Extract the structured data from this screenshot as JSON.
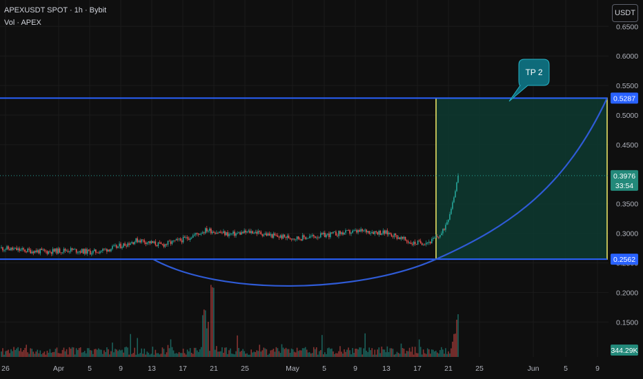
{
  "header": {
    "symbol_line": "APEXUSDT SPOT · 1h · Bybit",
    "volume_line": "Vol · APEX",
    "currency_button": "USDT"
  },
  "colors": {
    "background": "#0f0f0f",
    "level_line": "#2962ff",
    "curve": "#2f5bd6",
    "target_box_border": "#f7f06a",
    "target_box_fill": "#0d3a30",
    "bull": "#26a69a",
    "bear": "#ef5350",
    "label_tag": "#0e6b7a",
    "price_tag": "#23897a"
  },
  "annotations": {
    "tp_label": "TP 2",
    "upper_level": "0.5287",
    "lower_level": "0.2562",
    "current_price": "0.3976",
    "countdown": "33:54",
    "volume_value": "344.29K"
  },
  "chart_data": {
    "type": "candlestick",
    "interval": "1h",
    "y_axis_ticks": [
      "0.6500",
      "0.6000",
      "0.5500",
      "0.5000",
      "0.4500",
      "0.3500",
      "0.3000",
      "0.2500",
      "0.2000",
      "0.1500"
    ],
    "ylim": [
      0.12,
      0.66
    ],
    "x_axis_ticks": [
      "26",
      "Apr",
      "5",
      "9",
      "13",
      "17",
      "21",
      "25",
      "May",
      "5",
      "9",
      "13",
      "17",
      "21",
      "25",
      "Jun",
      "5",
      "9"
    ],
    "price_path": [
      {
        "t": 0,
        "price": 0.275
      },
      {
        "t": 0.05,
        "price": 0.271
      },
      {
        "t": 0.1,
        "price": 0.269
      },
      {
        "t": 0.15,
        "price": 0.272
      },
      {
        "t": 0.2,
        "price": 0.268
      },
      {
        "t": 0.25,
        "price": 0.276
      },
      {
        "t": 0.3,
        "price": 0.289
      },
      {
        "t": 0.35,
        "price": 0.28
      },
      {
        "t": 0.4,
        "price": 0.29
      },
      {
        "t": 0.45,
        "price": 0.306
      },
      {
        "t": 0.5,
        "price": 0.298
      },
      {
        "t": 0.55,
        "price": 0.303
      },
      {
        "t": 0.6,
        "price": 0.295
      },
      {
        "t": 0.65,
        "price": 0.292
      },
      {
        "t": 0.7,
        "price": 0.296
      },
      {
        "t": 0.75,
        "price": 0.301
      },
      {
        "t": 0.8,
        "price": 0.304
      },
      {
        "t": 0.85,
        "price": 0.3
      },
      {
        "t": 0.9,
        "price": 0.283
      },
      {
        "t": 0.94,
        "price": 0.286
      },
      {
        "t": 0.965,
        "price": 0.3
      },
      {
        "t": 0.98,
        "price": 0.33
      },
      {
        "t": 0.99,
        "price": 0.36
      },
      {
        "t": 1.0,
        "price": 0.3976
      }
    ],
    "last_price": 0.3976,
    "levels": [
      0.5287,
      0.2562
    ],
    "target_box": {
      "from_price": 0.2562,
      "to_price": 0.5287
    },
    "rounded_bottom_low": 0.203,
    "volume_last": "344.29K"
  }
}
